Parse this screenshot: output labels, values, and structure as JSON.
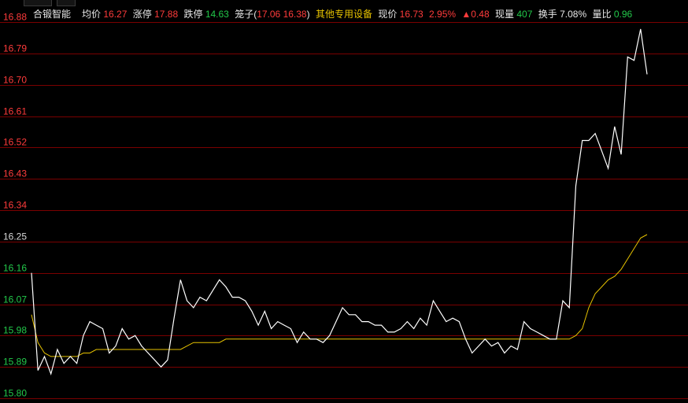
{
  "stock": {
    "name": "合锻智能",
    "avg_label": "均价",
    "avg_value": "16.27",
    "limit_up_label": "涨停",
    "limit_up_value": "17.88",
    "limit_down_label": "跌停",
    "limit_down_value": "14.63",
    "cage_label": "笼子(",
    "cage_low": "17.06",
    "cage_high": "16.38",
    "cage_close": ")",
    "sector": "其他专用设备",
    "price_label": "现价",
    "price_value": "16.73",
    "change_pct": "2.95%",
    "change_value": "▲0.48",
    "volume_label": "现量",
    "volume_value": "407",
    "turnover_label": "换手",
    "turnover_value": "7.08%",
    "ratio_label": "量比",
    "ratio_value": "0.96"
  },
  "colors": {
    "background": "#000000",
    "grid": "#7a0000",
    "price_line": "#ffffff",
    "avg_line": "#e6c200",
    "up_text": "#ff3b3b",
    "down_text": "#22c84a"
  },
  "chart_data": {
    "type": "line",
    "y_ticks": [
      "16.88",
      "16.79",
      "16.70",
      "16.61",
      "16.52",
      "16.43",
      "16.34",
      "16.25",
      "16.16",
      "16.07",
      "15.98",
      "15.89",
      "15.80"
    ],
    "y_tick_values": [
      16.88,
      16.79,
      16.7,
      16.61,
      16.52,
      16.43,
      16.34,
      16.25,
      16.16,
      16.07,
      15.98,
      15.89,
      15.8
    ],
    "prev_close": 16.25,
    "ylim": [
      15.8,
      16.88
    ],
    "grid": true,
    "series": [
      {
        "key": "price",
        "color": "#ffffff",
        "values": [
          16.16,
          15.88,
          15.92,
          15.87,
          15.94,
          15.9,
          15.92,
          15.9,
          15.98,
          16.02,
          16.01,
          16.0,
          15.93,
          15.95,
          16.0,
          15.97,
          15.98,
          15.95,
          15.93,
          15.91,
          15.89,
          15.91,
          16.03,
          16.14,
          16.08,
          16.06,
          16.09,
          16.08,
          16.11,
          16.14,
          16.12,
          16.09,
          16.09,
          16.08,
          16.05,
          16.01,
          16.05,
          16.0,
          16.02,
          16.01,
          16.0,
          15.96,
          15.99,
          15.97,
          15.97,
          15.96,
          15.98,
          16.02,
          16.06,
          16.04,
          16.04,
          16.02,
          16.02,
          16.01,
          16.01,
          15.99,
          15.99,
          16.0,
          16.02,
          16.0,
          16.03,
          16.01,
          16.08,
          16.05,
          16.02,
          16.03,
          16.02,
          15.97,
          15.93,
          15.95,
          15.97,
          15.95,
          15.96,
          15.93,
          15.95,
          15.94,
          16.02,
          16.0,
          15.99,
          15.98,
          15.97,
          15.97,
          16.08,
          16.06,
          16.41,
          16.54,
          16.54,
          16.56,
          16.51,
          16.46,
          16.58,
          16.5,
          16.78,
          16.77,
          16.86,
          16.73
        ]
      },
      {
        "key": "average",
        "color": "#e6c200",
        "values": [
          16.04,
          15.96,
          15.93,
          15.92,
          15.92,
          15.92,
          15.92,
          15.92,
          15.93,
          15.93,
          15.94,
          15.94,
          15.94,
          15.94,
          15.94,
          15.94,
          15.94,
          15.94,
          15.94,
          15.94,
          15.94,
          15.94,
          15.94,
          15.94,
          15.95,
          15.96,
          15.96,
          15.96,
          15.96,
          15.96,
          15.97,
          15.97,
          15.97,
          15.97,
          15.97,
          15.97,
          15.97,
          15.97,
          15.97,
          15.97,
          15.97,
          15.97,
          15.97,
          15.97,
          15.97,
          15.97,
          15.97,
          15.97,
          15.97,
          15.97,
          15.97,
          15.97,
          15.97,
          15.97,
          15.97,
          15.97,
          15.97,
          15.97,
          15.97,
          15.97,
          15.97,
          15.97,
          15.97,
          15.97,
          15.97,
          15.97,
          15.97,
          15.97,
          15.97,
          15.97,
          15.97,
          15.97,
          15.97,
          15.97,
          15.97,
          15.97,
          15.97,
          15.97,
          15.97,
          15.97,
          15.97,
          15.97,
          15.97,
          15.97,
          15.98,
          16.0,
          16.06,
          16.1,
          16.12,
          16.14,
          16.15,
          16.17,
          16.2,
          16.23,
          16.26,
          16.27
        ]
      }
    ]
  }
}
